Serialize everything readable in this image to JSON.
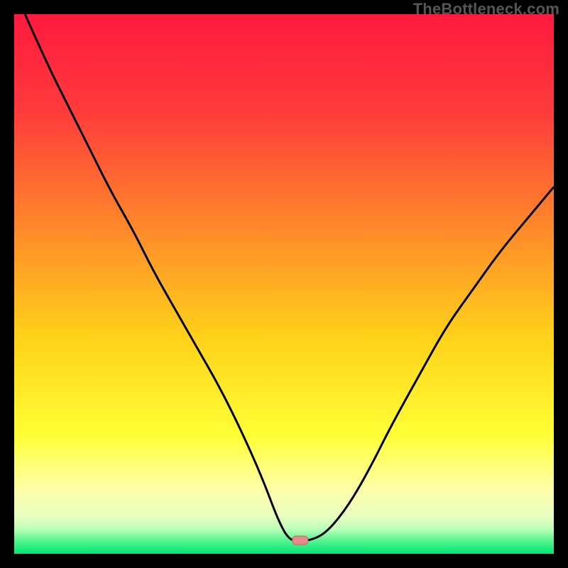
{
  "watermark": "TheBottleneck.com",
  "colors": {
    "frame": "#000000",
    "gradient_stops": [
      {
        "offset": 0.0,
        "color": "#ff1a3f"
      },
      {
        "offset": 0.18,
        "color": "#ff3b3b"
      },
      {
        "offset": 0.4,
        "color": "#ff8a2a"
      },
      {
        "offset": 0.6,
        "color": "#ffd21a"
      },
      {
        "offset": 0.78,
        "color": "#ffff35"
      },
      {
        "offset": 0.88,
        "color": "#ffffa8"
      },
      {
        "offset": 0.93,
        "color": "#e8ffc0"
      },
      {
        "offset": 0.955,
        "color": "#b8ffb8"
      },
      {
        "offset": 0.975,
        "color": "#58f58f"
      },
      {
        "offset": 1.0,
        "color": "#00e676"
      }
    ],
    "curve": "#000000",
    "marker_fill": "#e88a8a",
    "marker_stroke": "#c86868"
  },
  "chart_data": {
    "type": "line",
    "title": "",
    "xlabel": "",
    "ylabel": "",
    "xlim": [
      0,
      100
    ],
    "ylim": [
      0,
      100
    ],
    "legend": false,
    "grid": false,
    "series": [
      {
        "name": "bottleneck-curve",
        "x": [
          2,
          6,
          10,
          14,
          18,
          22,
          26,
          30,
          34,
          38,
          42,
          46,
          49,
          51,
          53,
          55,
          58,
          62,
          66,
          70,
          75,
          80,
          85,
          90,
          95,
          100
        ],
        "y": [
          100,
          91,
          83,
          75,
          67,
          60,
          52,
          45,
          38,
          31,
          23,
          14,
          6,
          2.5,
          2.5,
          2.5,
          4,
          9,
          16,
          24,
          33,
          42,
          49,
          56,
          62,
          68
        ]
      }
    ],
    "marker": {
      "x": 53,
      "y": 2.5,
      "shape": "rounded-rect"
    },
    "background": "vertical-gradient"
  }
}
